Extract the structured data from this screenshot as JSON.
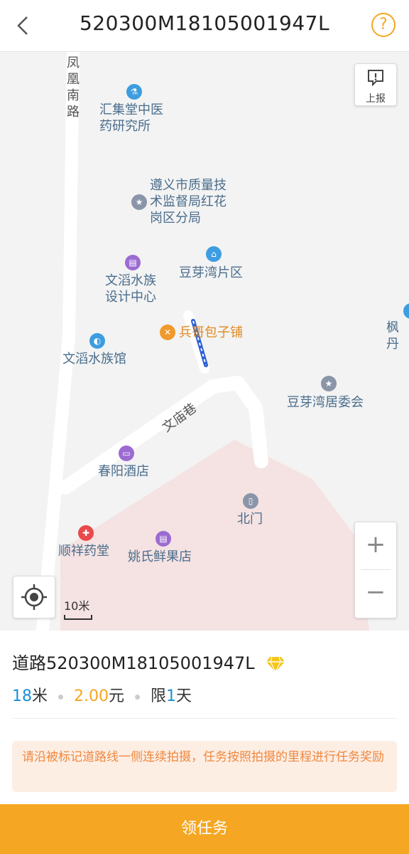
{
  "header": {
    "title": "520300M18105001947L",
    "help_label": "?"
  },
  "map": {
    "report_label": "上报",
    "scale_label": "10米",
    "zoom_in_label": "+",
    "zoom_out_label": "−",
    "road_names": {
      "fenghuang": "凤\n凰\n南\n路",
      "wenmiao": "文庙巷"
    },
    "pois": {
      "huijitang": "汇集堂中医\n药研究所",
      "zhiliang": "遵义市质量技\n术监督局红花\n岗区分局",
      "douyawan_area": "豆芽湾片区",
      "wendao_design": "文滔水族\n设计中心",
      "binge": "兵哥包子铺",
      "fengdan": "枫丹",
      "wendao_hall": "文滔水族馆",
      "douyawan_committee": "豆芽湾居委会",
      "chunyang": "春阳酒店",
      "beimen": "北门",
      "shunxiang": "顺祥药堂",
      "yaoshi": "姚氏鲜果店"
    },
    "colors": {
      "task_road": "#2d5fd6",
      "area_fill": "#f5e2e2"
    }
  },
  "task": {
    "road_prefix": "道路",
    "road_id": "520300M18105001947L",
    "distance_value": "18",
    "distance_unit": "米",
    "reward_value": "2.00",
    "reward_unit": "元",
    "limit_prefix": "限",
    "limit_value": "1",
    "limit_unit": "天",
    "notice": "请沿被标记道路线一侧连续拍摄，任务按照拍摄的里程进行任务奖励"
  },
  "action": {
    "accept_label": "领任务"
  },
  "theme": {
    "accent": "#f5a623",
    "blue": "#1a8fd8"
  }
}
